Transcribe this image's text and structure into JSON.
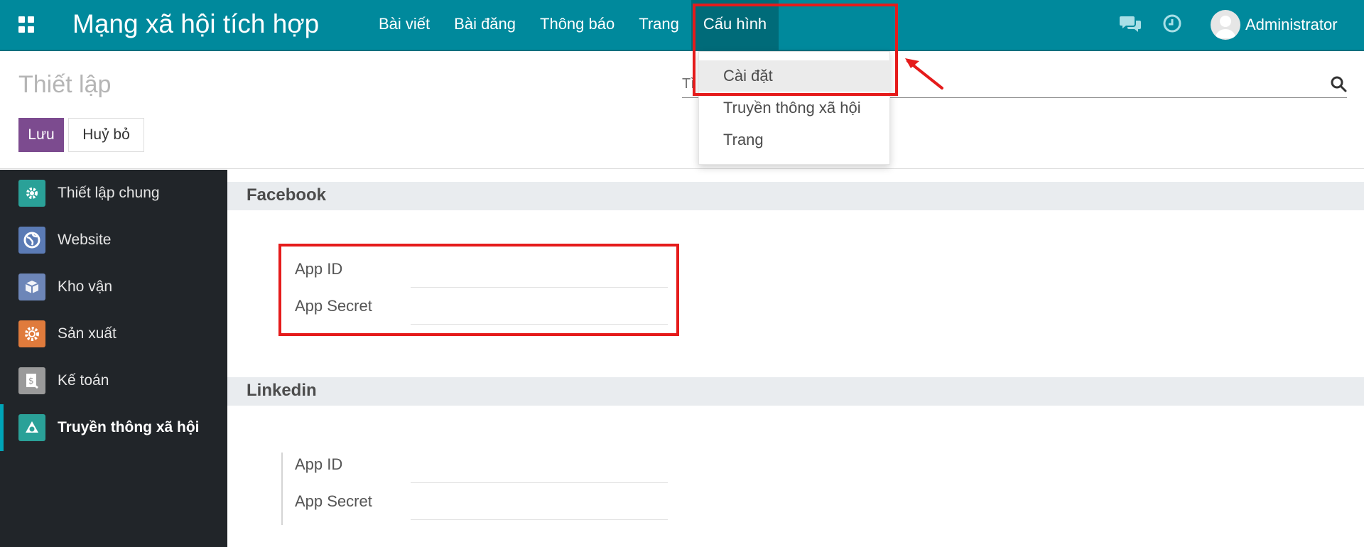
{
  "navbar": {
    "brand": "Mạng xã hội tích hợp",
    "menu": [
      {
        "label": "Bài viết"
      },
      {
        "label": "Bài đăng"
      },
      {
        "label": "Thông báo"
      },
      {
        "label": "Trang"
      },
      {
        "label": "Cấu hình"
      }
    ],
    "user_name": "Administrator",
    "bg_color": "#00899c"
  },
  "control": {
    "title": "Thiết lập",
    "save_label": "Lưu",
    "cancel_label": "Huỷ bỏ",
    "search_placeholder": "Tì"
  },
  "dropdown": {
    "items": [
      {
        "label": "Cài đặt"
      },
      {
        "label": "Truyền thông xã hội"
      },
      {
        "label": "Trang"
      }
    ]
  },
  "sidebar": {
    "items": [
      {
        "label": "Thiết lập chung",
        "icon": "gear-icon",
        "color": "#2aa198"
      },
      {
        "label": "Website",
        "icon": "globe-icon",
        "color": "#5b7bb5"
      },
      {
        "label": "Kho vận",
        "icon": "box-icon",
        "color": "#6d86b8"
      },
      {
        "label": "Sản xuất",
        "icon": "cog-icon",
        "color": "#e07b3c"
      },
      {
        "label": "Kế toán",
        "icon": "invoice-icon",
        "color": "#9a9a9a"
      },
      {
        "label": "Truyền thông xã hội",
        "icon": "megaphone-icon",
        "color": "#2aa198"
      }
    ]
  },
  "sections": [
    {
      "title": "Facebook",
      "fields": [
        {
          "label": "App ID",
          "value": ""
        },
        {
          "label": "App Secret",
          "value": ""
        }
      ]
    },
    {
      "title": "Linkedin",
      "fields": [
        {
          "label": "App ID",
          "value": ""
        },
        {
          "label": "App Secret",
          "value": ""
        }
      ]
    }
  ],
  "annotation_color": "#e51b1b"
}
